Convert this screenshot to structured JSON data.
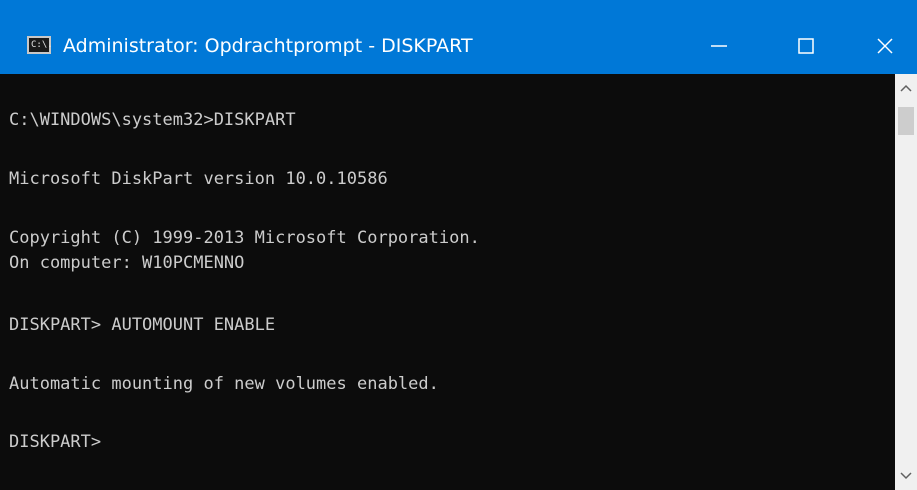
{
  "window": {
    "title": "Administrator: Opdrachtprompt - DISKPART",
    "icon": "cmd-icon",
    "icon_text": "C:\\."
  },
  "controls": {
    "minimize": "minimize-icon",
    "maximize": "maximize-icon",
    "close": "close-icon"
  },
  "console": {
    "lines": [
      "C:\\WINDOWS\\system32>DISKPART",
      "Microsoft DiskPart version 10.0.10586",
      "Copyright (C) 1999-2013 Microsoft Corporation.",
      "On computer: W10PCMENNO",
      "DISKPART> AUTOMOUNT ENABLE",
      "Automatic mounting of new volumes enabled.",
      "DISKPART>"
    ]
  },
  "colors": {
    "titlebar": "#0078d7",
    "console_bg": "#0c0c0c",
    "console_text": "#cccccc",
    "scrollbar_bg": "#f0f0f0"
  }
}
